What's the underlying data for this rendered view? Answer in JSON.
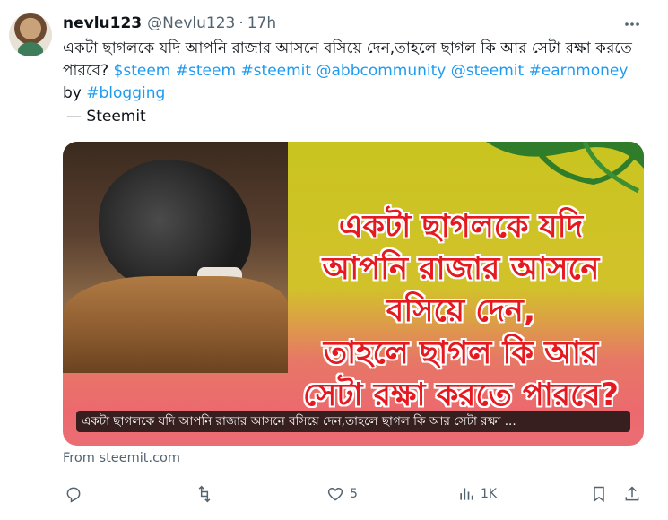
{
  "tweet": {
    "author_name": "nevlu123",
    "author_handle": "@Nevlu123",
    "separator": "·",
    "time": "17h",
    "text_main": "একটা ছাগলকে যদি আপনি রাজার আসনে বসিয়ে দেন,তাহলে ছাগল কি আর সেটা রক্ষা করতে পারবে?",
    "cashtag": "$steem",
    "hashtags": [
      "#steem",
      "#steemit",
      "@abbcommunity",
      "@steemit",
      "#earnmoney"
    ],
    "by_word": "by",
    "last_tag": "#blogging",
    "source_line": "— Steemit"
  },
  "card": {
    "title_lines": [
      "একটা ছাগলকে যদি",
      "আপনি রাজার আসনে",
      "বসিয়ে দেন,",
      "তাহলে ছাগল কি আর",
      "সেটা রক্ষা করতে পারবে?"
    ],
    "caption": "একটা ছাগলকে যদি আপনি রাজার আসনে বসিয়ে দেন,তাহলে ছাগল কি আর সেটা রক্ষা ...",
    "from_label": "From steemit.com"
  },
  "actions": {
    "reply_count": "",
    "retweet_count": "",
    "like_count": "5",
    "views_count": "1K"
  },
  "colors": {
    "link": "#1d9bf0",
    "muted": "#536471",
    "title_red": "#e5191f"
  }
}
